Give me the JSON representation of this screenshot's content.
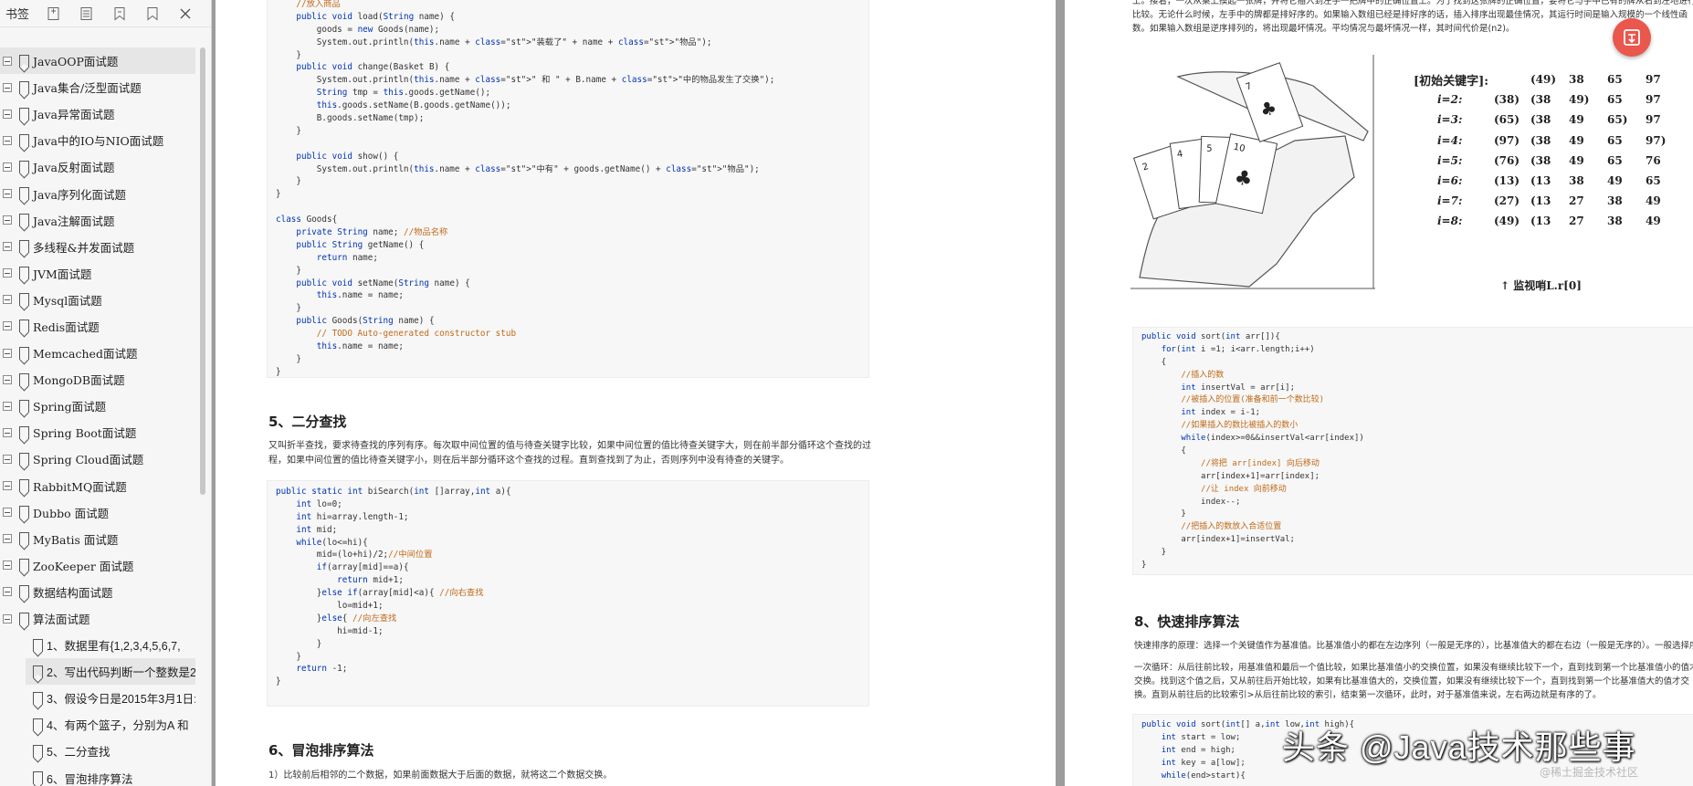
{
  "sidebar": {
    "title": "书签",
    "toolbar_icons": [
      "bookmark-add-icon",
      "bookmark-expand-icon",
      "bookmark-collapse-icon",
      "bookmark-outline-icon",
      "close-icon"
    ],
    "items": [
      {
        "label": "JavaOOP面试题",
        "level": 0,
        "selected": true
      },
      {
        "label": "Java集合/泛型面试题",
        "level": 0
      },
      {
        "label": "Java异常面试题",
        "level": 0
      },
      {
        "label": "Java中的IO与NIO面试题",
        "level": 0
      },
      {
        "label": "Java反射面试题",
        "level": 0
      },
      {
        "label": "Java序列化面试题",
        "level": 0
      },
      {
        "label": "Java注解面试题",
        "level": 0
      },
      {
        "label": "多线程&并发面试题",
        "level": 0
      },
      {
        "label": "JVM面试题",
        "level": 0
      },
      {
        "label": "Mysql面试题",
        "level": 0
      },
      {
        "label": "Redis面试题",
        "level": 0
      },
      {
        "label": "Memcached面试题",
        "level": 0
      },
      {
        "label": "MongoDB面试题",
        "level": 0
      },
      {
        "label": "Spring面试题",
        "level": 0
      },
      {
        "label": "Spring Boot面试题",
        "level": 0
      },
      {
        "label": "Spring Cloud面试题",
        "level": 0
      },
      {
        "label": "RabbitMQ面试题",
        "level": 0
      },
      {
        "label": "Dubbo 面试题",
        "level": 0
      },
      {
        "label": "MyBatis 面试题",
        "level": 0
      },
      {
        "label": "ZooKeeper 面试题",
        "level": 0
      },
      {
        "label": "数据结构面试题",
        "level": 0
      },
      {
        "label": "算法面试题",
        "level": 0
      },
      {
        "label": "1、数据里有{1,2,3,4,5,6,7,",
        "level": 1
      },
      {
        "label": "2、写出代码判断一个整数是2",
        "level": 1,
        "selected": true
      },
      {
        "label": "3、假设今日是2015年3月1日:",
        "level": 1
      },
      {
        "label": "4、有两个篮子，分别为A 和",
        "level": 1
      },
      {
        "label": "5、二分查找",
        "level": 1
      },
      {
        "label": "6、冒泡排序算法",
        "level": 1
      }
    ]
  },
  "left_page": {
    "code1": [
      "    //放入商品",
      "    public void load(String name) {",
      "        goods = new Goods(name);",
      "        System.out.println(this.name + \"装载了\" + name + \"物品\");",
      "    }",
      "    public void change(Basket B) {",
      "        System.out.println(this.name + \" 和 \" + B.name + \"中的物品发生了交换\");",
      "        String tmp = this.goods.getName();",
      "        this.goods.setName(B.goods.getName());",
      "        B.goods.setName(tmp);",
      "    }",
      "",
      "    public void show() {",
      "        System.out.println(this.name + \"中有\" + goods.getName() + \"物品\");",
      "    }",
      "}",
      "",
      "class Goods{",
      "    private String name; //物品名称",
      "    public String getName() {",
      "        return name;",
      "    }",
      "    public void setName(String name) {",
      "        this.name = name;",
      "    }",
      "    public Goods(String name) {",
      "        // TODO Auto-generated constructor stub",
      "        this.name = name;",
      "    }",
      "}"
    ],
    "heading1": "5、二分查找",
    "para1": "又叫折半查找，要求待查找的序列有序。每次取中间位置的值与待查关键字比较，如果中间位置的值比待查关键字大，则在前半部分循环这个查找的过程，如果中间位置的值比待查关键字小，则在后半部分循环这个查找的过程。直到查找到了为止，否则序列中没有待查的关键字。",
    "code2": [
      "public static int biSearch(int []array,int a){",
      "    int lo=0;",
      "    int hi=array.length-1;",
      "    int mid;",
      "    while(lo<=hi){",
      "        mid=(lo+hi)/2;//中间位置",
      "        if(array[mid]==a){",
      "            return mid+1;",
      "        }else if(array[mid]<a){ //向右查找",
      "            lo=mid+1;",
      "        }else{ //向左查找",
      "            hi=mid-1;",
      "        }",
      "    }",
      "    return -1;",
      "}"
    ],
    "heading2": "6、冒泡排序算法",
    "para2": "1）比较前后相邻的二个数据，如果前面数据大于后面的数据，就将这二个数据交换。"
  },
  "right_page": {
    "intro": "上。接着，一次从桌上摸起一张牌，并将它插入到左手一把牌中的正确位置上。为了找到这张牌的正确位置，要将它与手中已有的牌从右到左地进行比较。无论什么时候，左手中的牌都是排好序的。如果输入数组已经是排好序的话，插入排序出现最佳情况，其运行时间是输入规模的一个线性函数。如果输入数组是逆序排列的，将出现最坏情况。平均情况与最坏情况一样，其时间代价是(n2)。",
    "figure_title": "[初始关键字]:",
    "sort_rows": [
      {
        "label": "",
        "cells": [
          "(49)",
          "38",
          "65",
          "97"
        ]
      },
      {
        "label": "i=2:",
        "cells": [
          "(38)",
          "(38",
          "49)",
          "65",
          "97"
        ]
      },
      {
        "label": "i=3:",
        "cells": [
          "(65)",
          "(38",
          "49",
          "65)",
          "97"
        ]
      },
      {
        "label": "i=4:",
        "cells": [
          "(97)",
          "(38",
          "49",
          "65",
          "97)"
        ]
      },
      {
        "label": "i=5:",
        "cells": [
          "(76)",
          "(38",
          "49",
          "65",
          "76"
        ]
      },
      {
        "label": "i=6:",
        "cells": [
          "(13)",
          "(13",
          "38",
          "49",
          "65"
        ]
      },
      {
        "label": "i=7:",
        "cells": [
          "(27)",
          "(13",
          "27",
          "38",
          "49"
        ]
      },
      {
        "label": "i=8:",
        "cells": [
          "(49)",
          "(13",
          "27",
          "38",
          "49"
        ]
      }
    ],
    "figure_caption": "↑ 监视哨L.r[0]",
    "code3": [
      "public void sort(int arr[]){",
      "    for(int i =1; i<arr.length;i++)",
      "    {",
      "        //插入的数",
      "        int insertVal = arr[i];",
      "        //被插入的位置(准备和前一个数比较)",
      "        int index = i-1;",
      "        //如果插入的数比被插入的数小",
      "        while(index>=0&&insertVal<arr[index])",
      "        {",
      "            //将把 arr[index] 向后移动",
      "            arr[index+1]=arr[index];",
      "            //让 index 向前移动",
      "            index--;",
      "        }",
      "        //把插入的数放入合适位置",
      "        arr[index+1]=insertVal;",
      "    }",
      "}"
    ],
    "heading3": "8、快速排序算法",
    "para3": "快速排序的原理：选择一个关键值作为基准值。比基准值小的都在左边序列（一般是无序的），比基准值大的都在右边（一般是无序的）。一般选择序列的第一个元素。",
    "para4": "一次循环：从后往前比较，用基准值和最后一个值比较，如果比基准值小的交换位置，如果没有继续比较下一个，直到找到第一个比基准值小的值才交换。找到这个值之后，又从前往后开始比较，如果有比基准值大的，交换位置，如果没有继续比较下一个，直到找到第一个比基准值大的值才交换。直到从前往后的比较索引>从后往前比较的索引，结束第一次循环，此时，对于基准值来说，左右两边就是有序的了。",
    "code4": [
      "public void sort(int[] a,int low,int high){",
      "    int start = low;",
      "    int end = high;",
      "    int key = a[low];",
      "    while(end>start){"
    ]
  },
  "watermark": {
    "main": "头条 @Java技术那些事",
    "sub": "@稀土掘金技术社区"
  },
  "colors": {
    "accent_fab": "#e9574d",
    "keyword": "#0033b3",
    "string": "#b0271b",
    "comment": "#c06a19"
  }
}
